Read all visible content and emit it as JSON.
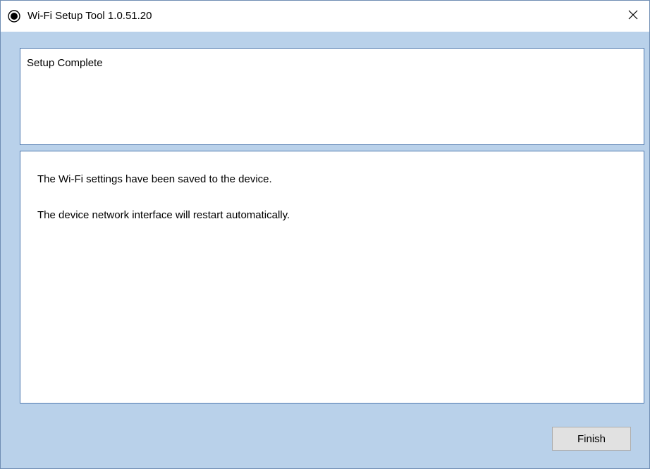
{
  "window": {
    "title": "Wi-Fi Setup Tool 1.0.51.20",
    "icon": "app-circle-icon",
    "close_icon": "close-icon"
  },
  "header": {
    "title": "Setup Complete"
  },
  "content": {
    "messages": [
      "The Wi-Fi settings have been saved to the device.",
      "The device network interface will restart automatically."
    ]
  },
  "footer": {
    "finish_label": "Finish"
  },
  "colors": {
    "window_background": "#b9d1ea",
    "panel_border": "#4f7ab0",
    "button_face": "#e1e1e1"
  }
}
